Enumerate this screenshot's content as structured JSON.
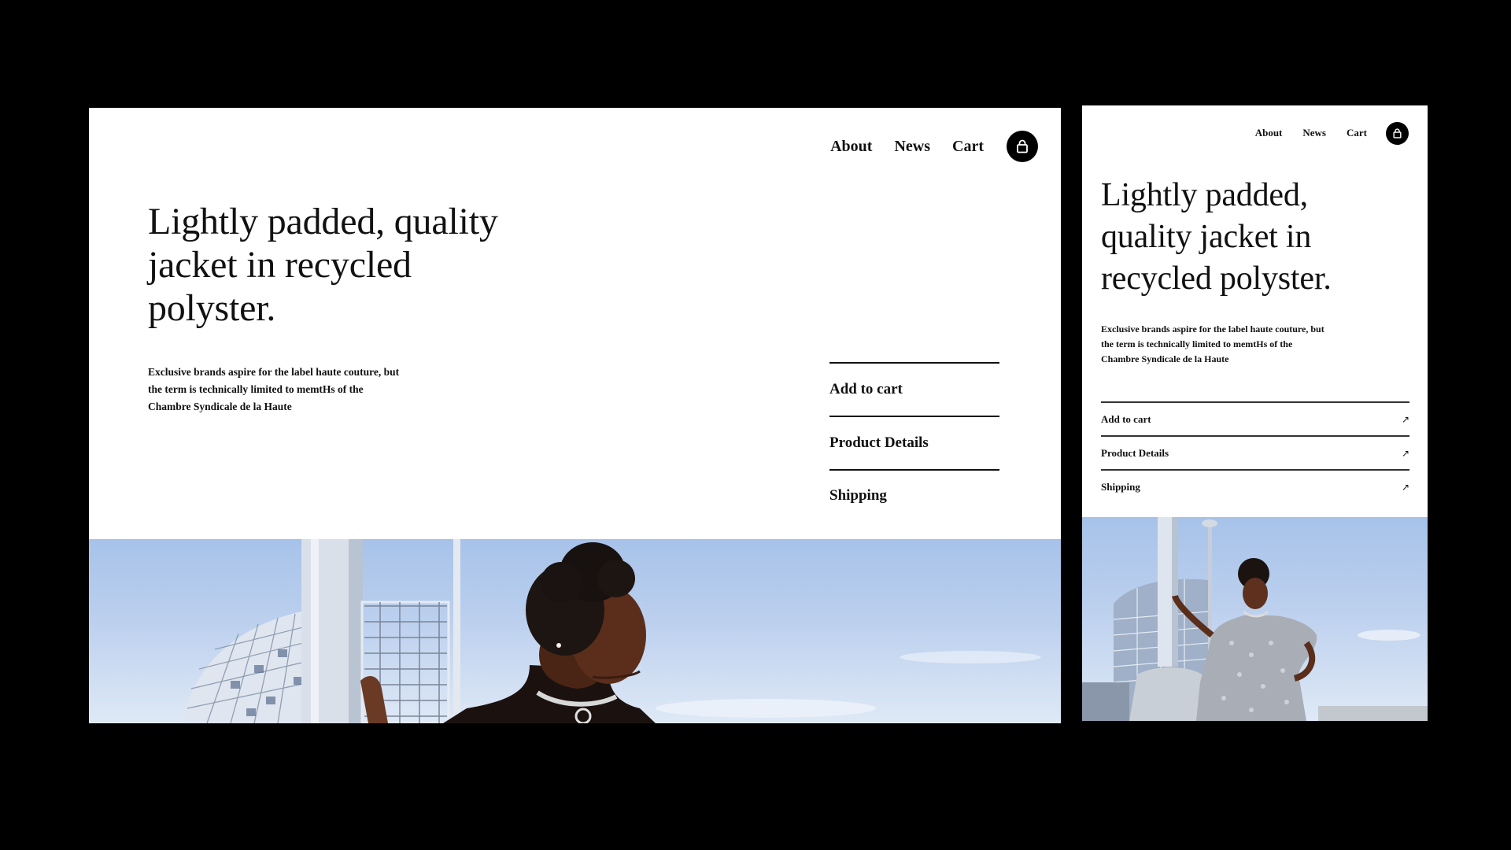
{
  "desktop": {
    "nav": {
      "items": [
        "About",
        "News",
        "Cart"
      ],
      "cart_icon": "shopping-bag-icon"
    },
    "headline": "Lightly padded, quality jacket in recycled polyster.",
    "description": "Exclusive brands aspire for the label haute couture, but the term is technically limited to memtHs of the Chambre Syndicale de la Haute",
    "accordion": [
      "Add to cart",
      "Product Details",
      "Shipping"
    ]
  },
  "mobile": {
    "nav": {
      "items": [
        "About",
        "News",
        "Cart"
      ],
      "cart_icon": "shopping-bag-icon"
    },
    "headline": "Lightly padded, quality jacket in recycled polyster.",
    "description": "Exclusive brands aspire for the label haute couture, but the term is technically limited to memtHs of the Chambre Syndicale de la Haute",
    "accordion": [
      {
        "label": "Add to cart",
        "icon": "arrow-up-right-icon",
        "glyph": "↗"
      },
      {
        "label": "Product Details",
        "icon": "arrow-up-right-icon",
        "glyph": "↗"
      },
      {
        "label": "Shipping",
        "icon": "arrow-up-right-icon",
        "glyph": "↗"
      }
    ]
  },
  "colors": {
    "background": "#000000",
    "page": "#ffffff",
    "text": "#111111",
    "sky": "#a7c2e9"
  }
}
